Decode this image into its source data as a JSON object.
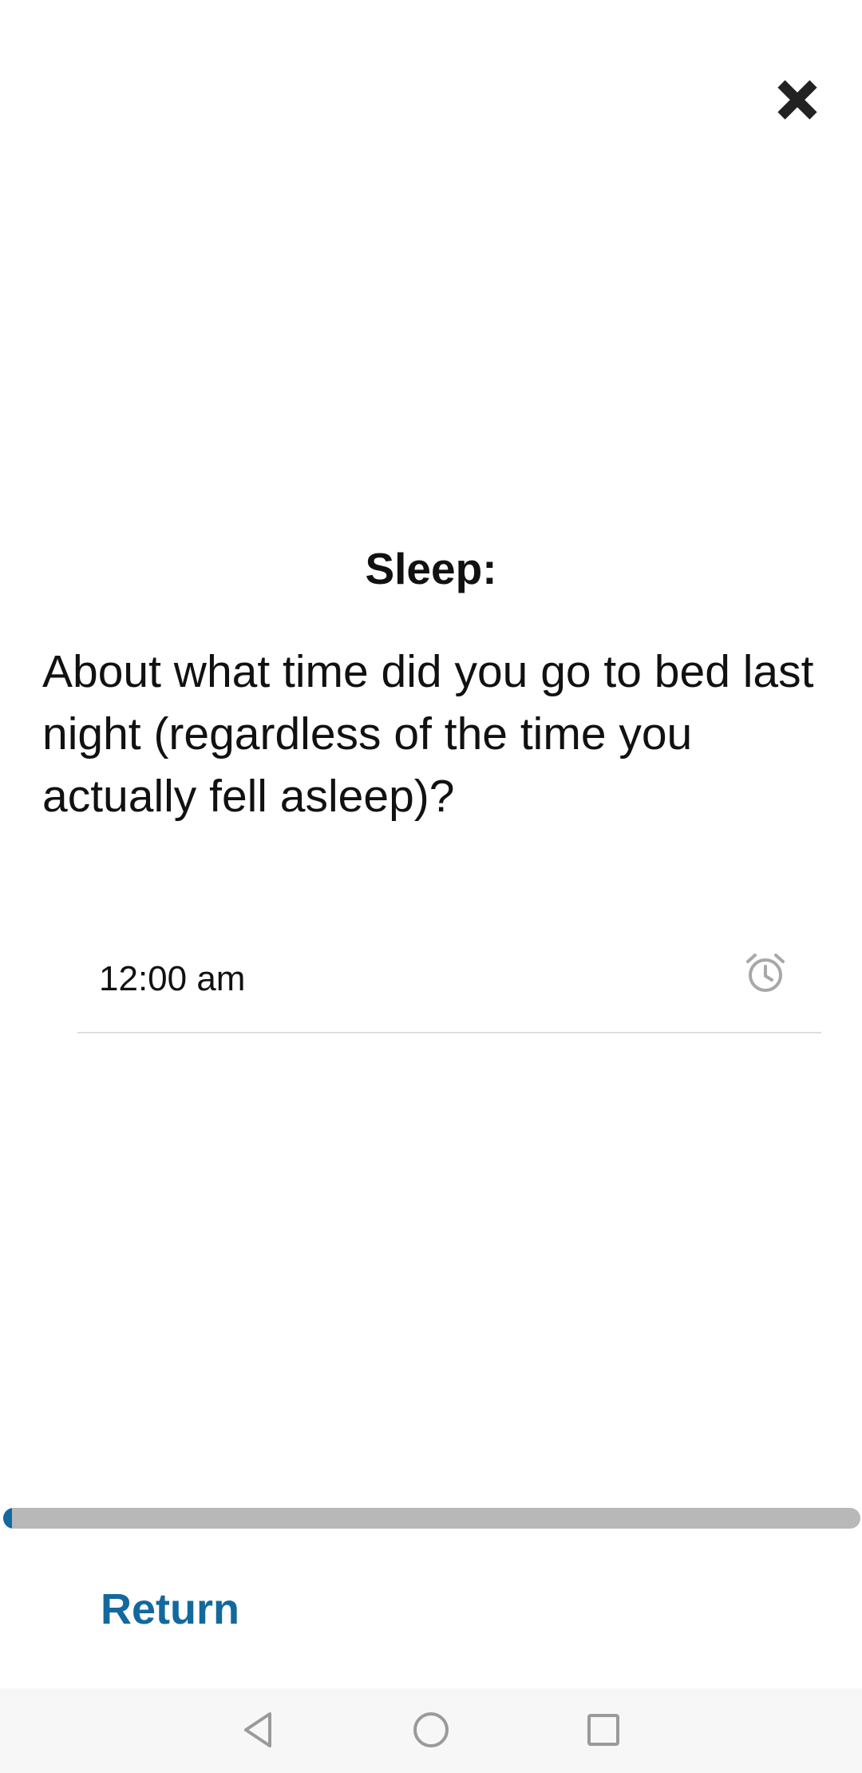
{
  "header": {
    "close_icon": "close-icon"
  },
  "content": {
    "section_title": "Sleep:",
    "question": "About what time did you go to bed last night (regardless of the time you actually fell asleep)?"
  },
  "time_input": {
    "value": "12:00 am",
    "icon": "alarm-clock-icon"
  },
  "progress": {
    "fraction": 0.01
  },
  "footer": {
    "return_label": "Return"
  },
  "nav_bar": {
    "buttons": [
      "back-icon",
      "home-icon",
      "recents-icon"
    ]
  },
  "colors": {
    "accent": "#13699d",
    "progress_track": "#b8b8b8",
    "progress_fill": "#1469a0",
    "text": "#111111",
    "divider": "#dedede"
  }
}
